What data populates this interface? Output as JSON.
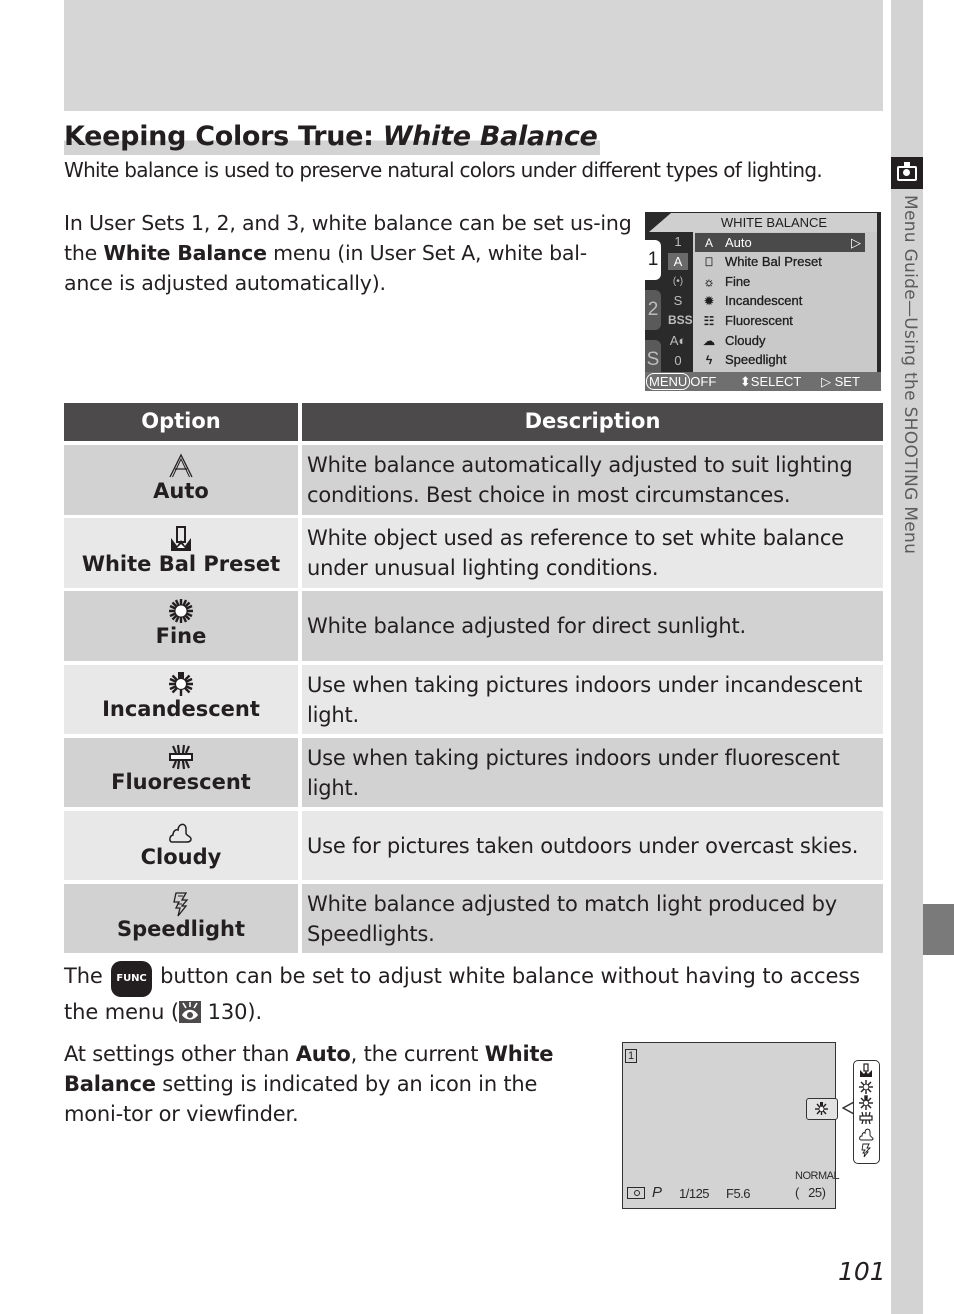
{
  "section_title": {
    "main": "Keeping Colors True: ",
    "emph": "White Balance"
  },
  "intro": "White balance is used to preserve natural colors under different types of lighting.",
  "para1": {
    "a": "In User Sets 1, 2, and 3, white balance can be set us-ing the ",
    "bold": "White Balance",
    "b": " menu (in User Set A, white bal-ance is adjusted automatically)."
  },
  "side_tab": {
    "label": "Menu Guide—Using the SHOOTING Menu",
    "icon": "camera-icon"
  },
  "camera_menu": {
    "title": "WHITE BALANCE",
    "tabs": [
      "1",
      "2",
      "S"
    ],
    "active_tab": "1",
    "items": [
      {
        "icon": "auto-icon",
        "glyph": "A",
        "label": "Auto",
        "selected": true
      },
      {
        "icon": "white-bal-preset-icon",
        "glyph": "⎕",
        "label": "White Bal Preset"
      },
      {
        "icon": "fine-icon",
        "glyph": "☼",
        "label": "Fine"
      },
      {
        "icon": "incandescent-icon",
        "glyph": "✹",
        "label": "Incandescent"
      },
      {
        "icon": "fluorescent-icon",
        "glyph": "☷",
        "label": "Fluorescent"
      },
      {
        "icon": "cloudy-icon",
        "glyph": "☁",
        "label": "Cloudy"
      },
      {
        "icon": "speedlight-icon",
        "glyph": "ϟ",
        "label": "Speedlight"
      }
    ],
    "set_icons": [
      "1",
      "A",
      "(•)",
      "S",
      "BSS",
      "A◐",
      "0"
    ],
    "footer": {
      "menu_key": "MENU",
      "menu_action": "OFF",
      "select": "⬍SELECT",
      "set": "▷ SET"
    }
  },
  "table": {
    "headers": {
      "option": "Option",
      "description": "Description"
    },
    "rows": [
      {
        "icon": "auto-icon",
        "option": "Auto",
        "description": "White balance automatically adjusted to suit lighting conditions.  Best choice in most circumstances."
      },
      {
        "icon": "white-bal-preset-icon",
        "option": "White Bal Preset",
        "description": "White object used as reference to set white balance under unusual lighting conditions."
      },
      {
        "icon": "fine-icon",
        "option": "Fine",
        "description": "White balance adjusted for direct sunlight."
      },
      {
        "icon": "incandescent-icon",
        "option": "Incandescent",
        "description": "Use when taking pictures indoors under incandescent light."
      },
      {
        "icon": "fluorescent-icon",
        "option": "Fluorescent",
        "description": "Use when taking pictures indoors under fluorescent light."
      },
      {
        "icon": "cloudy-icon",
        "option": "Cloudy",
        "description": "Use for pictures taken outdoors under overcast skies."
      },
      {
        "icon": "speedlight-icon",
        "option": "Speedlight",
        "description": "White balance adjusted to match light produced by Speedlights."
      }
    ]
  },
  "para2": {
    "a": "The ",
    "func": "FUNC",
    "b": " button can be set to adjust white balance without having to access the menu (",
    "ref": " 130)."
  },
  "para3": {
    "a": "At settings other than ",
    "bold1": "Auto",
    "b": ", the current ",
    "bold2": "White Balance",
    "c": " setting is indicated by an icon in the moni-tor or viewfinder."
  },
  "monitor": {
    "user_set": "1",
    "metering": "center-icon",
    "mode": "P",
    "shutter": "1/125",
    "aperture": "F5.6",
    "quality": "NORMAL",
    "frames": "(   25)",
    "current_wb_icon": "incandescent-icon",
    "wb_icon_list": [
      "white-bal-preset-icon",
      "fine-icon",
      "incandescent-icon",
      "fluorescent-icon",
      "cloudy-icon",
      "speedlight-icon"
    ]
  },
  "page_number": "101",
  "colors": {
    "header_bg": "#4d4a4b",
    "row_dark": "#d2d2d2",
    "row_light": "#e8e8e8",
    "side_strip": "#d3d3d3",
    "side_tab": "#7a7a7a"
  }
}
